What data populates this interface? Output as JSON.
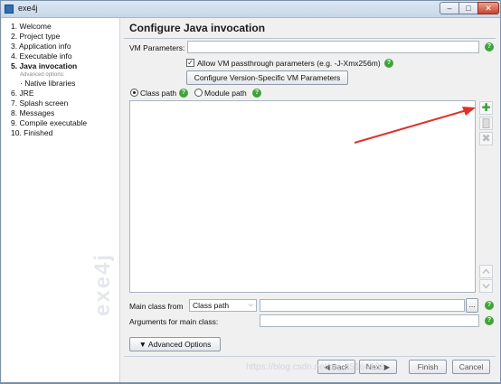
{
  "window": {
    "title": "exe4j",
    "min": "–",
    "max": "□",
    "close": "✕"
  },
  "sidebar": {
    "steps": [
      {
        "label": "1. Welcome",
        "kind": "step"
      },
      {
        "label": "2. Project type",
        "kind": "step"
      },
      {
        "label": "3. Application info",
        "kind": "step"
      },
      {
        "label": "4. Executable info",
        "kind": "step"
      },
      {
        "label": "5. Java invocation",
        "kind": "active"
      },
      {
        "label": "Advanced options:",
        "kind": "sub-heading"
      },
      {
        "label": "· Native libraries",
        "kind": "sub"
      },
      {
        "label": "6. JRE",
        "kind": "step"
      },
      {
        "label": "7. Splash screen",
        "kind": "step"
      },
      {
        "label": "8. Messages",
        "kind": "step"
      },
      {
        "label": "9. Compile executable",
        "kind": "step"
      },
      {
        "label": "10. Finished",
        "kind": "step"
      }
    ],
    "watermark": "exe4j"
  },
  "main": {
    "title": "Configure Java invocation",
    "vm_parameters_label": "VM Parameters:",
    "vm_parameters_value": "",
    "allow_passthrough_label": "Allow VM passthrough parameters (e.g. -J-Xmx256m)",
    "allow_passthrough_checked": "✓",
    "version_specific_button": "Configure Version-Specific VM Parameters",
    "class_path_label": "Class path",
    "module_path_label": "Module path",
    "add_icon": "✚",
    "remove_icon": "✖",
    "main_class_label": "Main class from",
    "main_class_source": "Class path",
    "main_class_value": "",
    "browse_label": "...",
    "arguments_label": "Arguments for main class:",
    "arguments_value": "",
    "advanced_options_button": "Advanced Options",
    "help_glyph": "?"
  },
  "footer": {
    "back": "◀ Back",
    "next": "Next ▶",
    "finish": "Finish",
    "cancel": "Cancel",
    "credit": "https://blog.csdn.net/qq_45160138"
  },
  "colors": {
    "help_green": "#3ea43a",
    "arrow_red": "#e0322a",
    "add_green": "#2e9e2e"
  }
}
